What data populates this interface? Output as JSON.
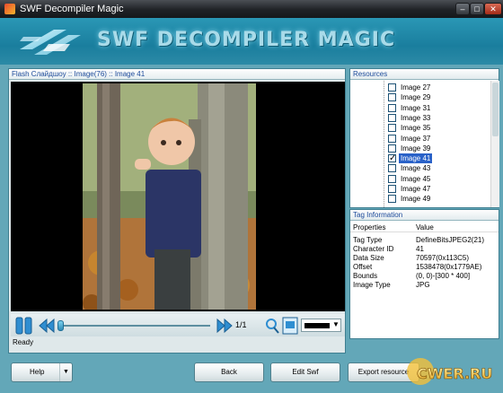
{
  "window": {
    "title": "SWF Decompiler Magic"
  },
  "banner": {
    "title": "SWF DECOMPILER MAGIC"
  },
  "preview": {
    "breadcrumb": "Flash Слайдшоу :: Image(76) :: Image 41",
    "frame_counter": "1/1",
    "status": "Ready"
  },
  "resources": {
    "header": "Resources",
    "items": [
      {
        "label": "Image 27",
        "checked": false,
        "selected": false
      },
      {
        "label": "Image 29",
        "checked": false,
        "selected": false
      },
      {
        "label": "Image 31",
        "checked": false,
        "selected": false
      },
      {
        "label": "Image 33",
        "checked": false,
        "selected": false
      },
      {
        "label": "Image 35",
        "checked": false,
        "selected": false
      },
      {
        "label": "Image 37",
        "checked": false,
        "selected": false
      },
      {
        "label": "Image 39",
        "checked": false,
        "selected": false
      },
      {
        "label": "Image 41",
        "checked": true,
        "selected": true
      },
      {
        "label": "Image 43",
        "checked": false,
        "selected": false
      },
      {
        "label": "Image 45",
        "checked": false,
        "selected": false
      },
      {
        "label": "Image 47",
        "checked": false,
        "selected": false
      },
      {
        "label": "Image 49",
        "checked": false,
        "selected": false
      }
    ]
  },
  "tag_info": {
    "header": "Tag Information",
    "col_properties": "Properties",
    "col_value": "Value",
    "rows": [
      {
        "property": "Tag Type",
        "value": "DefineBitsJPEG2(21)"
      },
      {
        "property": "Character ID",
        "value": "41"
      },
      {
        "property": "Data Size",
        "value": "70597(0x113C5)"
      },
      {
        "property": "Offset",
        "value": "1538478(0x1779AE)"
      },
      {
        "property": "Bounds",
        "value": "(0, 0)-[300 * 400]"
      },
      {
        "property": "Image Type",
        "value": "JPG"
      }
    ]
  },
  "buttons": {
    "help": "Help",
    "back": "Back",
    "edit_swf": "Edit Swf",
    "export": "Export resource"
  },
  "watermark": "CWER.RU",
  "colors": {
    "accent": "#2a97b5",
    "selection": "#2a62c8",
    "title_bar": "#1f2226"
  },
  "icons": [
    "app-icon",
    "play-pause-icon",
    "rewind-icon",
    "fast-forward-icon",
    "zoom-tool-icon",
    "fit-view-icon",
    "dropdown-arrow-icon"
  ]
}
